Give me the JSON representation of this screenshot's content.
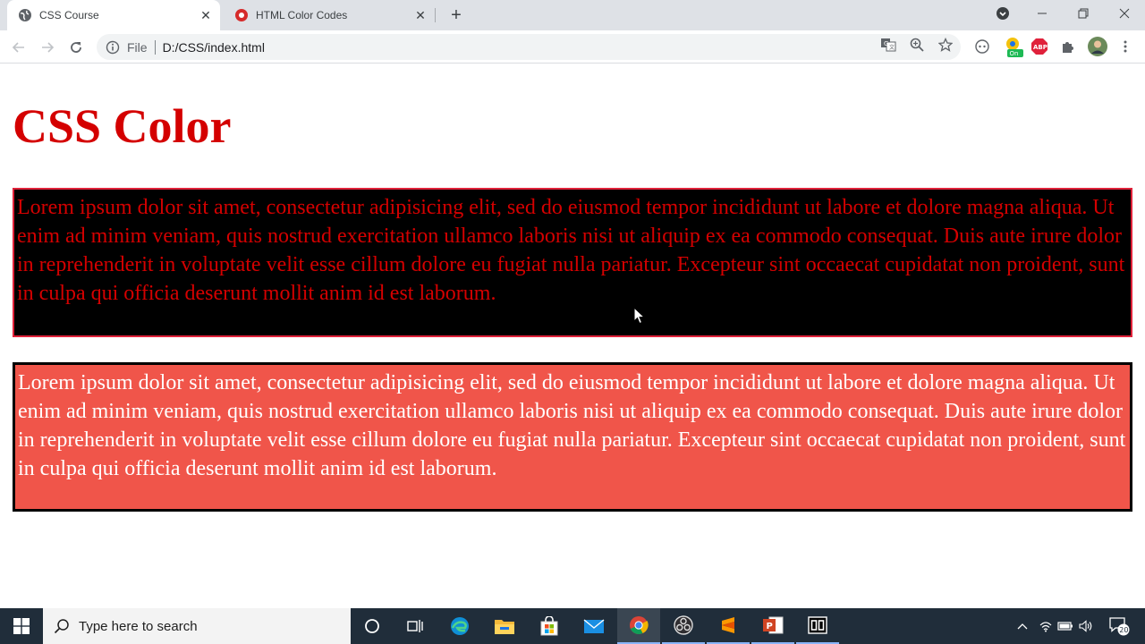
{
  "browser": {
    "tabs": [
      {
        "title": "CSS Course",
        "active": true,
        "favicon": "globe-icon"
      },
      {
        "title": "HTML Color Codes",
        "active": false,
        "favicon": "opera-like-icon"
      }
    ],
    "address": {
      "scheme_label": "File",
      "url": "D:/CSS/index.html"
    }
  },
  "page": {
    "heading": "CSS Color",
    "paragraph1": "Lorem ipsum dolor sit amet, consectetur adipisicing elit, sed do eiusmod tempor incididunt ut labore et dolore magna aliqua. Ut enim ad minim veniam, quis nostrud exercitation ullamco laboris nisi ut aliquip ex ea commodo consequat. Duis aute irure dolor in reprehenderit in voluptate velit esse cillum dolore eu fugiat nulla pariatur. Excepteur sint occaecat cupidatat non proident, sunt in culpa qui officia deserunt mollit anim id est laborum.",
    "paragraph2": "Lorem ipsum dolor sit amet, consectetur adipisicing elit, sed do eiusmod tempor incididunt ut labore et dolore magna aliqua. Ut enim ad minim veniam, quis nostrud exercitation ullamco laboris nisi ut aliquip ex ea commodo consequat. Duis aute irure dolor in reprehenderit in voluptate velit esse cillum dolore eu fugiat nulla pariatur. Excepteur sint occaecat cupidatat non proident, sunt in culpa qui officia deserunt mollit anim id est laborum."
  },
  "extensions": {
    "toggle_badge": "On",
    "abp_label": "ABP"
  },
  "taskbar": {
    "search_placeholder": "Type here to search",
    "notification_count": "20"
  },
  "colors": {
    "heading": "#d40000",
    "para1_bg": "#000000",
    "para1_text": "#d40000",
    "para2_bg": "#f0554a",
    "para2_text": "#ffffff"
  }
}
